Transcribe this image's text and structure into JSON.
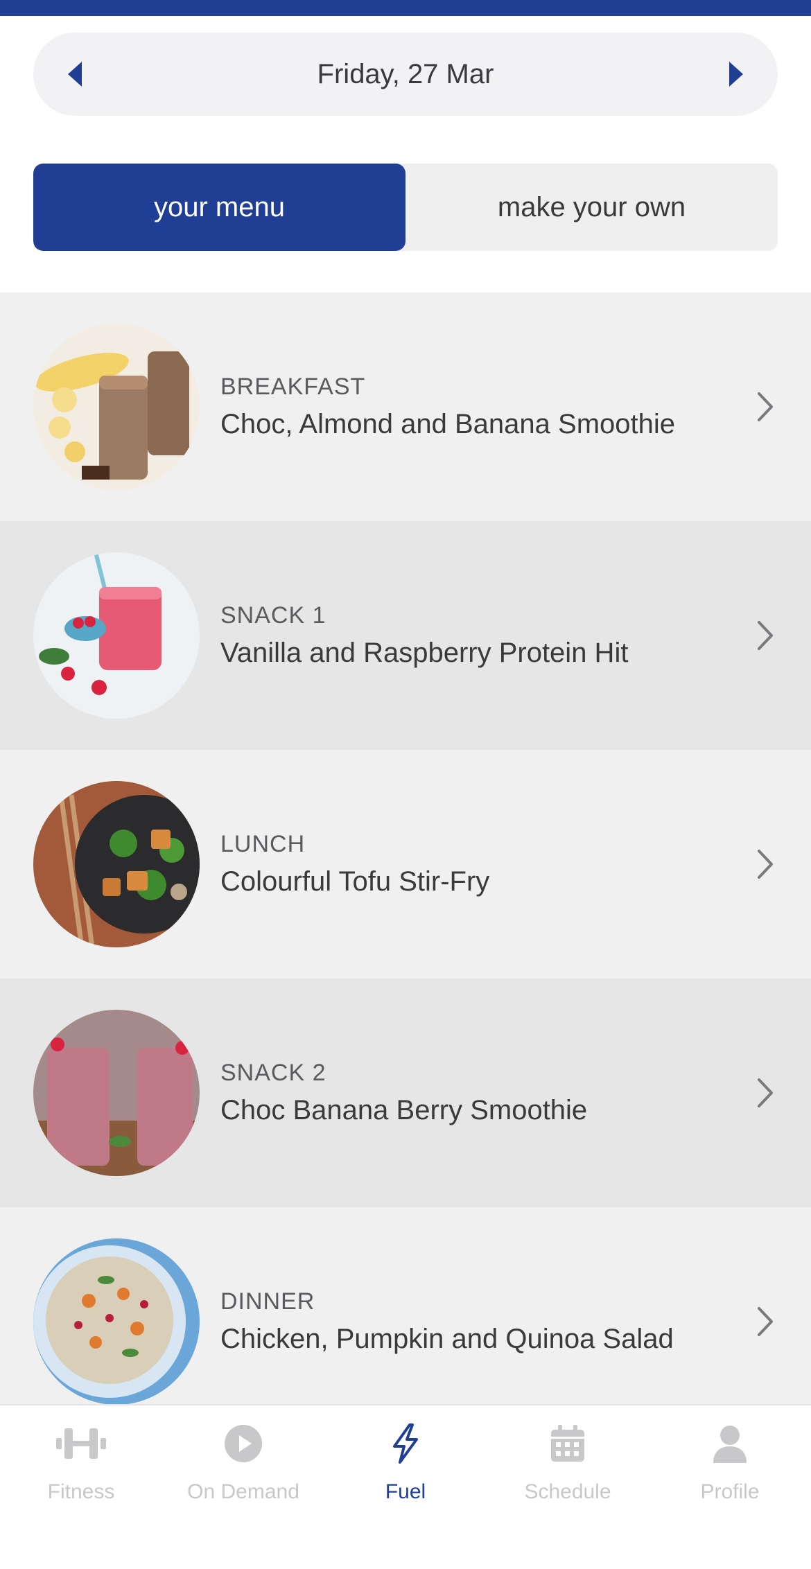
{
  "date_nav": {
    "date": "Friday, 27 Mar"
  },
  "segments": [
    {
      "label": "your menu",
      "active": true
    },
    {
      "label": "make your own",
      "active": false
    }
  ],
  "meals": [
    {
      "type": "BREAKFAST",
      "title": "Choc, Almond and Banana Smoothie"
    },
    {
      "type": "SNACK 1",
      "title": "Vanilla and Raspberry Protein Hit"
    },
    {
      "type": "LUNCH",
      "title": "Colourful Tofu Stir-Fry"
    },
    {
      "type": "SNACK 2",
      "title": "Choc Banana Berry Smoothie"
    },
    {
      "type": "DINNER",
      "title": "Chicken, Pumpkin and Quinoa Salad"
    }
  ],
  "bottom_nav": [
    {
      "label": "Fitness",
      "icon": "dumbbell-icon",
      "active": false
    },
    {
      "label": "On Demand",
      "icon": "play-icon",
      "active": false
    },
    {
      "label": "Fuel",
      "icon": "lightning-icon",
      "active": true
    },
    {
      "label": "Schedule",
      "icon": "calendar-icon",
      "active": false
    },
    {
      "label": "Profile",
      "icon": "person-icon",
      "active": false
    }
  ],
  "colors": {
    "brand": "#1f3e94",
    "row_light": "#f0f0f1",
    "row_dark": "#e6e6e7",
    "inactive_nav": "#c8c8cb"
  }
}
